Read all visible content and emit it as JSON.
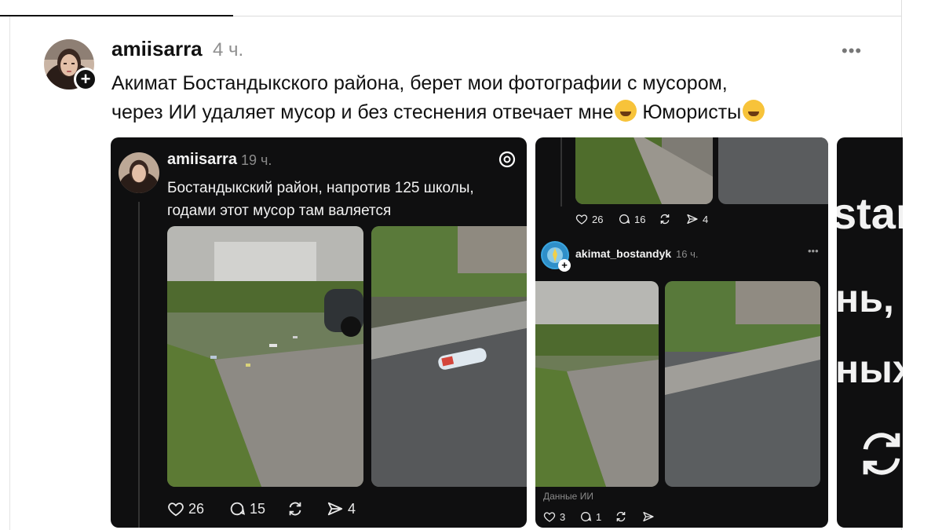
{
  "post": {
    "username": "amiisarra",
    "time": "4 ч.",
    "text_line1": "Акимат Бостандыкского района, берет мои фотографии с мусором,",
    "text_line2a": "через ИИ удаляет мусор и без стеснения отвечает мне",
    "text_line2b": " Юмористы"
  },
  "card1": {
    "username": "amiisarra",
    "time": "19 ч.",
    "text_line1": "Бостандыкский район, напротив 125 школы,",
    "text_line2": "годами этот мусор там валяется",
    "likes": "26",
    "comments": "15",
    "shares": "4"
  },
  "card2": {
    "top_likes": "26",
    "top_comments": "16",
    "top_shares": "4",
    "reply_username": "akimat_bostandyk",
    "reply_time": "16 ч.",
    "ai_label": "Данные ИИ",
    "likes": "3",
    "comments": "1"
  },
  "card3": {
    "text1": "star",
    "text2": "нь,",
    "text3": "ных"
  },
  "icons": [
    "threads-logo-icon",
    "heart-icon",
    "comment-icon",
    "repost-icon",
    "share-icon",
    "more-icon",
    "plus-icon"
  ]
}
